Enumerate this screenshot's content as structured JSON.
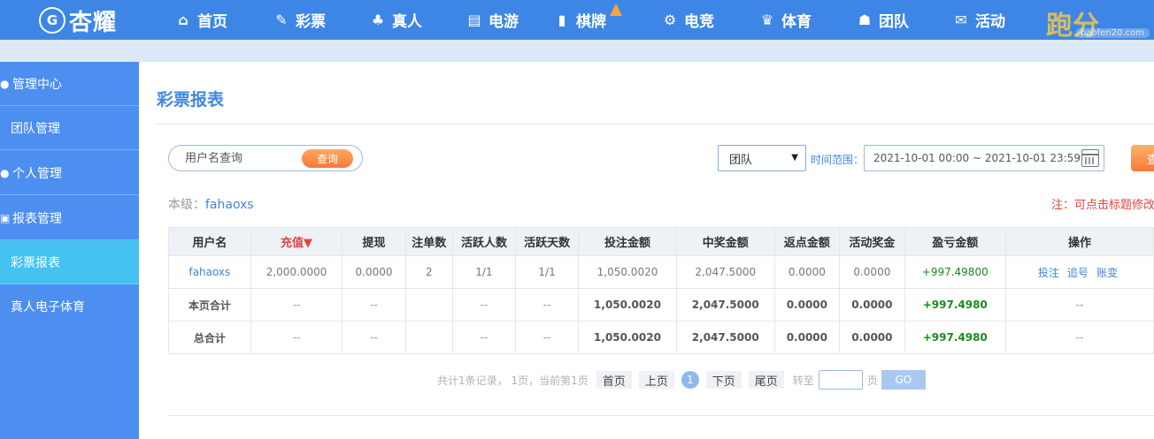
{
  "brand": {
    "badge": "G",
    "name": "杏耀"
  },
  "nav": [
    {
      "icon": "⌂",
      "label": "首页"
    },
    {
      "icon": "✎",
      "label": "彩票"
    },
    {
      "icon": "♣",
      "label": "真人"
    },
    {
      "icon": "▤",
      "label": "电游"
    },
    {
      "icon": "▮",
      "label": "棋牌"
    },
    {
      "icon": "⚙",
      "label": "电竞"
    },
    {
      "icon": "♛",
      "label": "体育"
    },
    {
      "icon": "☗",
      "label": "团队"
    },
    {
      "icon": "✉",
      "label": "活动"
    }
  ],
  "watermark": {
    "main": "跑分",
    "sub": "paofen20.com"
  },
  "sidebar": {
    "items": [
      {
        "label": "管理中心",
        "icon": "user-icon"
      },
      {
        "label": "团队管理"
      },
      {
        "label": "个人管理",
        "icon": "user-icon"
      },
      {
        "label": "报表管理",
        "icon": "report-icon"
      },
      {
        "label": "彩票报表",
        "active": true
      },
      {
        "label": "真人电子体育"
      }
    ]
  },
  "page": {
    "title": "彩票报表"
  },
  "filters": {
    "search_placeholder": "用户名查询",
    "search_button": "查询",
    "scope_value": "团队",
    "range_label": "时间范围：",
    "range_value": "2021-10-01 00:00 ~ 2021-10-01 23:59",
    "query_button": "查"
  },
  "level": {
    "label": "本级：",
    "user": "fahaoxs"
  },
  "note": "注：可点击标题修改",
  "table": {
    "headers": [
      "用户名",
      "充值▼",
      "提现",
      "注单数",
      "活跃人数",
      "活跃天数",
      "投注金额",
      "中奖金额",
      "返点金额",
      "活动奖金",
      "盈亏金额",
      "操作"
    ],
    "rows": [
      [
        "fahaoxs",
        "2,000.0000",
        "0.0000",
        "2",
        "1/1",
        "1/1",
        "1,050.0020",
        "2,047.5000",
        "0.0000",
        "0.0000",
        "+997.49800"
      ]
    ],
    "row_ops": [
      "投注",
      "追号",
      "账变"
    ],
    "summary": [
      [
        "本页合计",
        "--",
        "--",
        "",
        "--",
        "--",
        "1,050.0020",
        "2,047.5000",
        "0.0000",
        "0.0000",
        "+997.4980",
        "--"
      ],
      [
        "总合计",
        "--",
        "--",
        "",
        "--",
        "--",
        "1,050.0020",
        "2,047.5000",
        "0.0000",
        "0.0000",
        "+997.4980",
        "--"
      ]
    ]
  },
  "pager": {
    "info": "共计1条记录， 1页，当前第1页",
    "first": "首页",
    "prev": "上页",
    "current": "1",
    "next": "下页",
    "last": "尾页",
    "goto_label": "转至",
    "page_unit": "页",
    "go": "GO"
  }
}
